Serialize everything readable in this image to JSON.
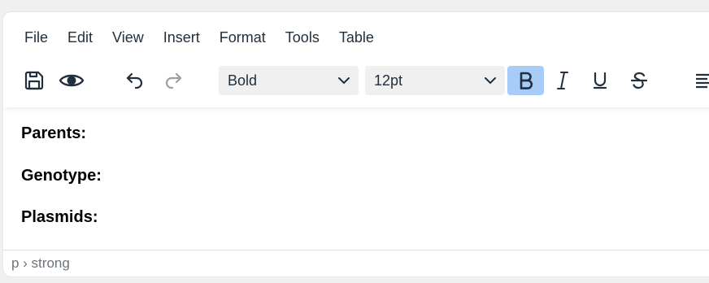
{
  "menubar": {
    "items": [
      {
        "label": "File"
      },
      {
        "label": "Edit"
      },
      {
        "label": "View"
      },
      {
        "label": "Insert"
      },
      {
        "label": "Format"
      },
      {
        "label": "Tools"
      },
      {
        "label": "Table"
      }
    ]
  },
  "toolbar": {
    "save_icon": "save-icon",
    "preview_icon": "eye-icon",
    "undo_icon": "undo-icon",
    "redo_icon": "redo-icon",
    "block_format": "Bold",
    "font_size": "12pt",
    "bold_active": true,
    "accent_color": "#a6ccf7"
  },
  "content": {
    "lines": [
      {
        "text": "Parents:"
      },
      {
        "text": "Genotype:"
      },
      {
        "text": "Plasmids:"
      }
    ]
  },
  "statusbar": {
    "path": "p › strong"
  }
}
